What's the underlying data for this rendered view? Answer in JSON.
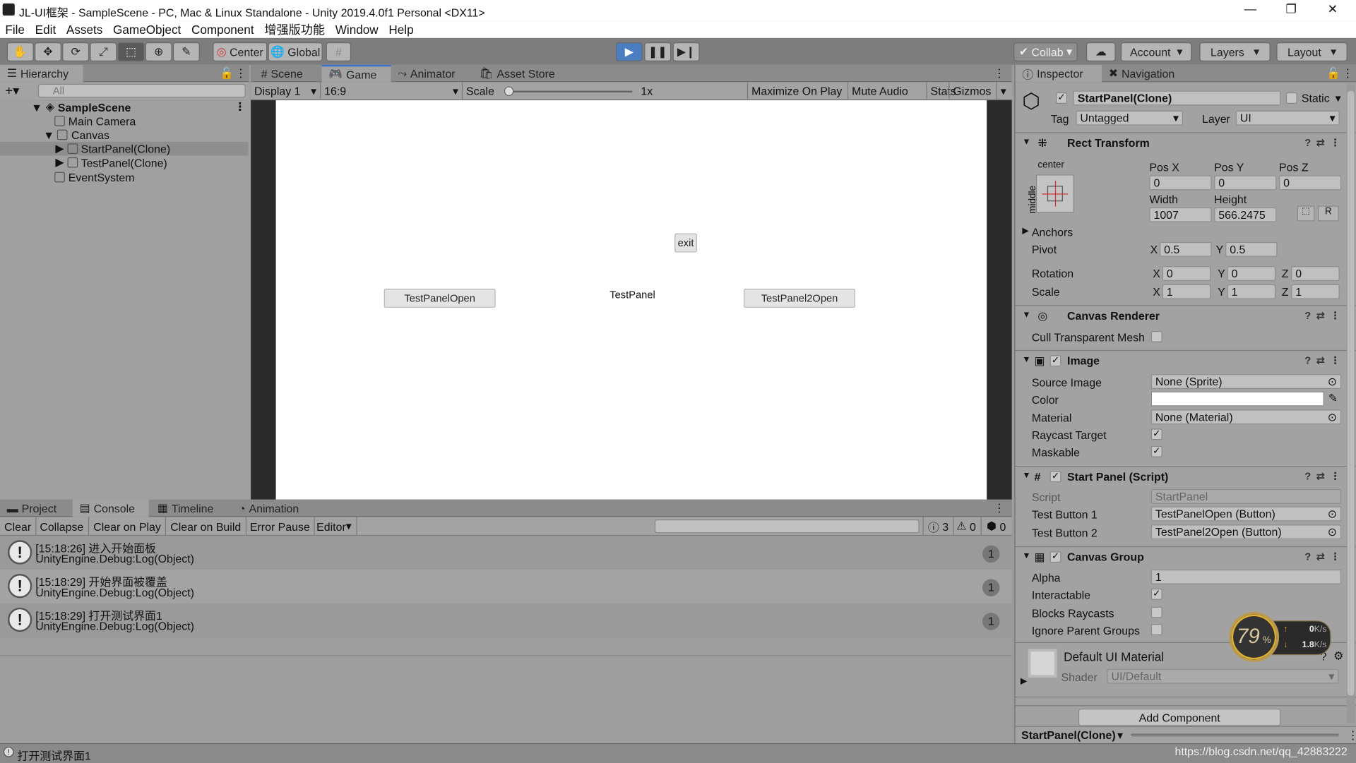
{
  "title": "JL-UI框架 - SampleScene - PC, Mac & Linux Standalone - Unity 2019.4.0f1 Personal <DX11>",
  "menu": [
    "File",
    "Edit",
    "Assets",
    "GameObject",
    "Component",
    "增强版功能",
    "Window",
    "Help"
  ],
  "toolbar": {
    "center": "Center",
    "global": "Global",
    "collab": "Collab",
    "account": "Account",
    "layers": "Layers",
    "layout": "Layout"
  },
  "hierarchy": {
    "tab": "Hierarchy",
    "search_placeholder": "All",
    "items": [
      {
        "label": "SampleScene"
      },
      {
        "label": "Main Camera"
      },
      {
        "label": "Canvas"
      },
      {
        "label": "StartPanel(Clone)"
      },
      {
        "label": "TestPanel(Clone)"
      },
      {
        "label": "EventSystem"
      }
    ]
  },
  "center_tabs": [
    "Scene",
    "Game",
    "Animator",
    "Asset Store"
  ],
  "game_toolbar": {
    "display": "Display 1",
    "aspect": "16:9",
    "scale_label": "Scale",
    "scale_value": "1x",
    "maximize": "Maximize On Play",
    "mute": "Mute Audio",
    "stats": "Stats",
    "gizmos": "Gizmos"
  },
  "scale_slider_fraction": 0,
  "game": {
    "exit": "exit",
    "btn1": "TestPanelOpen",
    "panel_text": "TestPanel",
    "btn2": "TestPanel2Open"
  },
  "bottom_tabs": [
    "Project",
    "Console",
    "Timeline",
    "Animation"
  ],
  "console": {
    "buttons": [
      "Clear",
      "Collapse",
      "Clear on Play",
      "Clear on Build",
      "Error Pause",
      "Editor"
    ],
    "counts": {
      "info": "3",
      "warn": "0",
      "error": "0"
    },
    "logs": [
      {
        "line1": "[15:18:26] 进入开始面板",
        "line2": "UnityEngine.Debug:Log(Object)",
        "count": "1"
      },
      {
        "line1": "[15:18:29] 开始界面被覆盖",
        "line2": "UnityEngine.Debug:Log(Object)",
        "count": "1"
      },
      {
        "line1": "[15:18:29] 打开测试界面1",
        "line2": "UnityEngine.Debug:Log(Object)",
        "count": "1"
      }
    ]
  },
  "inspector": {
    "tabs": [
      "Inspector",
      "Navigation"
    ],
    "name": "StartPanel(Clone)",
    "static": "Static",
    "tag_label": "Tag",
    "tag": "Untagged",
    "layer_label": "Layer",
    "layer": "UI",
    "rect": {
      "title": "Rect Transform",
      "anchor_h": "center",
      "anchor_v": "middle",
      "posx_l": "Pos X",
      "posy_l": "Pos Y",
      "posz_l": "Pos Z",
      "posx": "0",
      "posy": "0",
      "posz": "0",
      "w_l": "Width",
      "h_l": "Height",
      "w": "1007",
      "h": "566.2475",
      "r": "R",
      "anchors": "Anchors",
      "pivot": "Pivot",
      "pivot_x": "0.5",
      "pivot_y": "0.5",
      "rotation": "Rotation",
      "rx": "0",
      "ry": "0",
      "rz": "0",
      "scale": "Scale",
      "sx": "1",
      "sy": "1",
      "sz": "1",
      "X": "X",
      "Y": "Y",
      "Z": "Z"
    },
    "canvas_renderer": {
      "title": "Canvas Renderer",
      "cull": "Cull Transparent Mesh"
    },
    "image": {
      "title": "Image",
      "source": "Source Image",
      "source_v": "None (Sprite)",
      "color": "Color",
      "material": "Material",
      "material_v": "None (Material)",
      "raycast": "Raycast Target",
      "maskable": "Maskable"
    },
    "script": {
      "title": "Start Panel (Script)",
      "script": "Script",
      "script_v": "StartPanel",
      "b1": "Test Button 1",
      "b1_v": "TestPanelOpen (Button)",
      "b2": "Test Button 2",
      "b2_v": "TestPanel2Open (Button)"
    },
    "canvas_group": {
      "title": "Canvas Group",
      "alpha": "Alpha",
      "alpha_v": "1",
      "interactable": "Interactable",
      "blocks": "Blocks Raycasts",
      "ignore": "Ignore Parent Groups"
    },
    "material": {
      "name": "Default UI Material",
      "shader": "Shader",
      "shader_v": "UI/Default"
    },
    "add_component": "Add Component",
    "footer": "StartPanel(Clone)"
  },
  "net_widget": {
    "percent": "79",
    "unit": "%",
    "up": "0",
    "down": "1.8",
    "rate_unit": "K/s"
  },
  "status": {
    "message": "打开测试界面1",
    "watermark": "https://blog.csdn.net/qq_42883222"
  },
  "colors": {
    "accent": "#3a72c8",
    "play": "#4a7ec0"
  }
}
